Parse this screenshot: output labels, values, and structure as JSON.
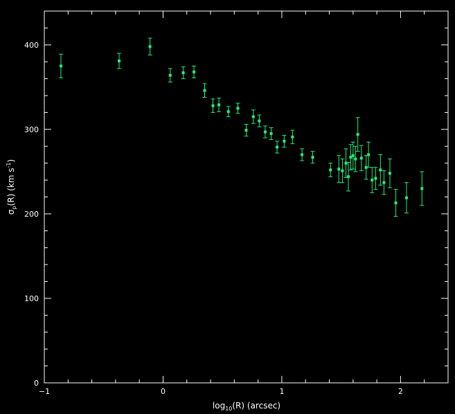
{
  "chart_data": {
    "type": "scatter",
    "title": "",
    "xlabel": {
      "prefix": "log",
      "subscript": "10",
      "suffix": "(R)  (arcsec)"
    },
    "ylabel": {
      "symbol": "σ",
      "subscript": "p",
      "suffix": "(R)  (km s",
      "superscript": "-1",
      "close": ")"
    },
    "xlim": [
      -1,
      2.4
    ],
    "ylim": [
      0,
      440
    ],
    "x_ticks": [
      {
        "value": -1,
        "label": "−1"
      },
      {
        "value": 0,
        "label": "0"
      },
      {
        "value": 1,
        "label": "1"
      },
      {
        "value": 2,
        "label": "2"
      }
    ],
    "y_ticks": [
      {
        "value": 0,
        "label": "0"
      },
      {
        "value": 100,
        "label": "100"
      },
      {
        "value": 200,
        "label": "200"
      },
      {
        "value": 300,
        "label": "300"
      },
      {
        "value": 400,
        "label": "400"
      }
    ],
    "grid": false,
    "colors": {
      "background": "#000000",
      "axes": "#ffffff",
      "points": "#22ee77"
    },
    "series": [
      {
        "points": [
          {
            "x": -0.86,
            "y": 375,
            "err": 14
          },
          {
            "x": -0.37,
            "y": 381,
            "err": 9
          },
          {
            "x": -0.11,
            "y": 398,
            "err": 10
          },
          {
            "x": 0.06,
            "y": 364,
            "err": 8
          },
          {
            "x": 0.17,
            "y": 367,
            "err": 7
          },
          {
            "x": 0.26,
            "y": 368,
            "err": 7
          },
          {
            "x": 0.35,
            "y": 346,
            "err": 8
          },
          {
            "x": 0.42,
            "y": 328,
            "err": 8
          },
          {
            "x": 0.47,
            "y": 329,
            "err": 8
          },
          {
            "x": 0.55,
            "y": 321,
            "err": 6
          },
          {
            "x": 0.63,
            "y": 325,
            "err": 6
          },
          {
            "x": 0.7,
            "y": 299,
            "err": 7
          },
          {
            "x": 0.76,
            "y": 315,
            "err": 8
          },
          {
            "x": 0.81,
            "y": 310,
            "err": 7
          },
          {
            "x": 0.86,
            "y": 297,
            "err": 7
          },
          {
            "x": 0.91,
            "y": 295,
            "err": 7
          },
          {
            "x": 0.96,
            "y": 279,
            "err": 7
          },
          {
            "x": 1.02,
            "y": 286,
            "err": 7
          },
          {
            "x": 1.09,
            "y": 291,
            "err": 8
          },
          {
            "x": 1.17,
            "y": 270,
            "err": 7
          },
          {
            "x": 1.26,
            "y": 267,
            "err": 7
          },
          {
            "x": 1.41,
            "y": 252,
            "err": 8
          },
          {
            "x": 1.48,
            "y": 253,
            "err": 16
          },
          {
            "x": 1.51,
            "y": 251,
            "err": 14
          },
          {
            "x": 1.54,
            "y": 260,
            "err": 17
          },
          {
            "x": 1.56,
            "y": 244,
            "err": 17
          },
          {
            "x": 1.58,
            "y": 267,
            "err": 15
          },
          {
            "x": 1.6,
            "y": 269,
            "err": 16
          },
          {
            "x": 1.62,
            "y": 265,
            "err": 15
          },
          {
            "x": 1.64,
            "y": 294,
            "err": 20
          },
          {
            "x": 1.67,
            "y": 266,
            "err": 15
          },
          {
            "x": 1.71,
            "y": 255,
            "err": 14
          },
          {
            "x": 1.73,
            "y": 270,
            "err": 15
          },
          {
            "x": 1.76,
            "y": 240,
            "err": 15
          },
          {
            "x": 1.79,
            "y": 242,
            "err": 13
          },
          {
            "x": 1.83,
            "y": 252,
            "err": 18
          },
          {
            "x": 1.86,
            "y": 237,
            "err": 14
          },
          {
            "x": 1.91,
            "y": 248,
            "err": 17
          },
          {
            "x": 1.96,
            "y": 213,
            "err": 16
          },
          {
            "x": 2.05,
            "y": 219,
            "err": 18
          },
          {
            "x": 2.18,
            "y": 230,
            "err": 20
          }
        ]
      }
    ]
  }
}
